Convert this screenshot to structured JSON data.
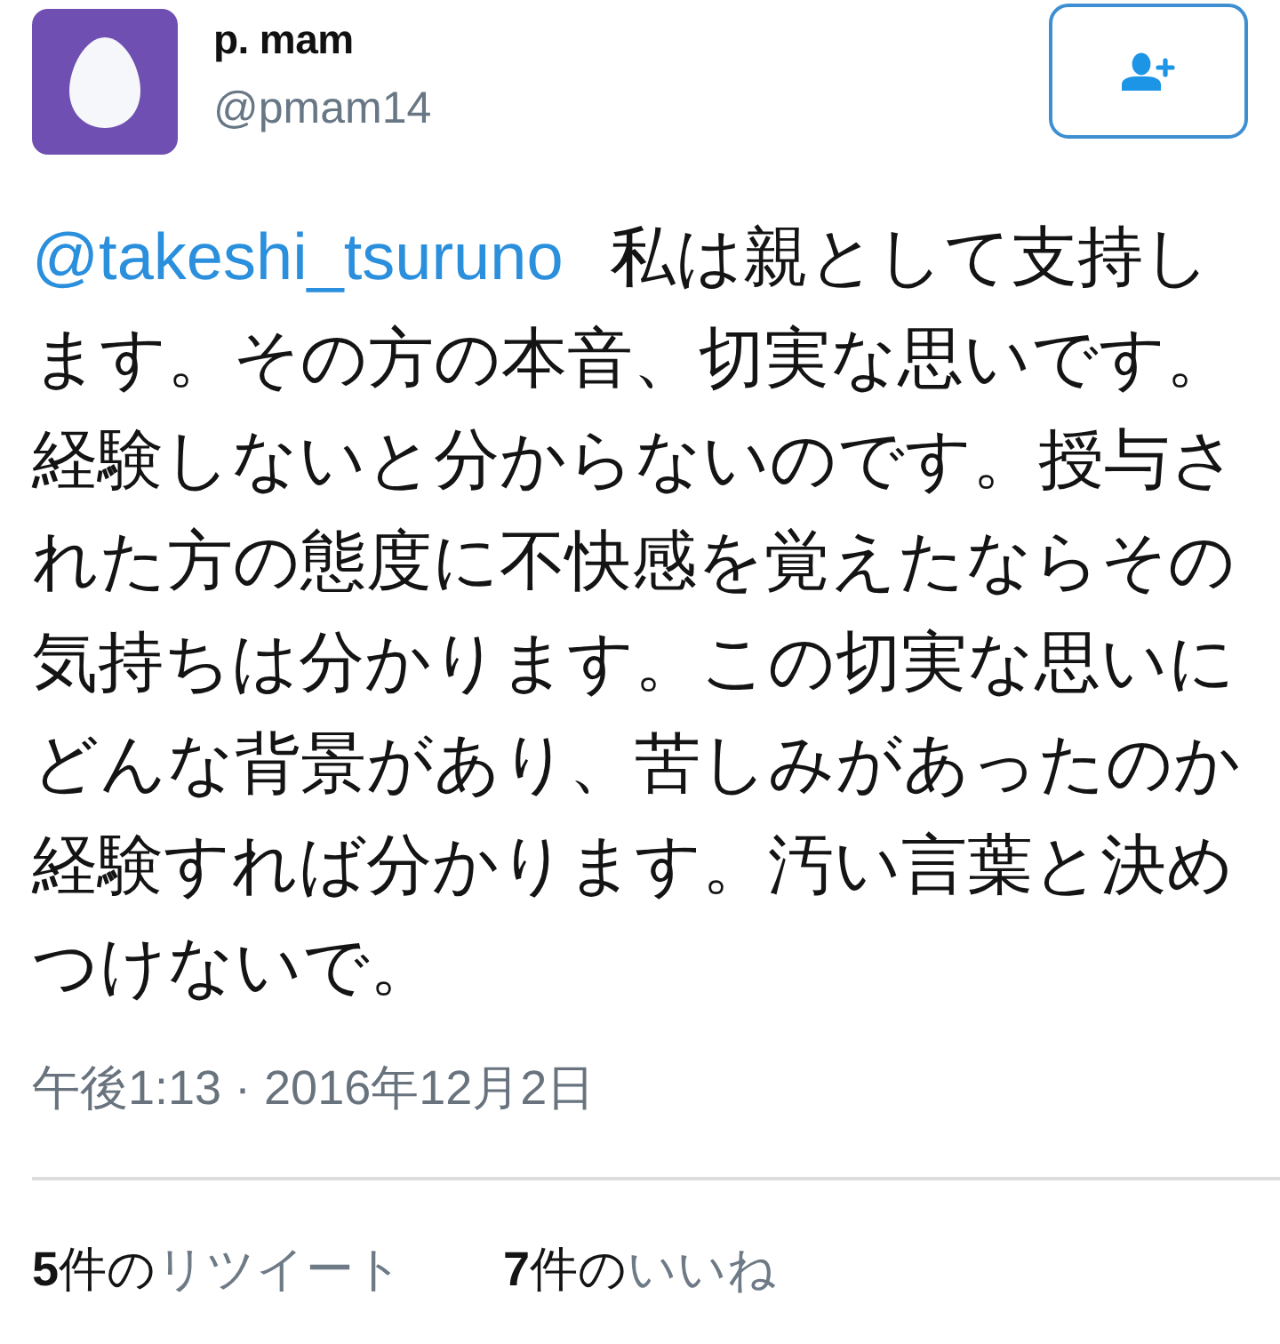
{
  "user": {
    "name": "p. mam",
    "handle": "@pmam14"
  },
  "tweet": {
    "mention": "@takeshi_tsuruno",
    "text": "私は親として支持します。その方の本音、切実な思いです。経験しないと分からないのです。授与された方の態度に不快感を覚えたならその気持ちは分かります。この切実な思いにどんな背景があり、苦しみがあったのか経験すれば分かります。汚い言葉と決めつけないで。"
  },
  "timestamp": "午後1:13 · 2016年12月2日",
  "stats": [
    {
      "count": "**5**件の",
      "label": "リツイート"
    },
    {
      "count": "**7**件の",
      "label": "いいね"
    }
  ]
}
